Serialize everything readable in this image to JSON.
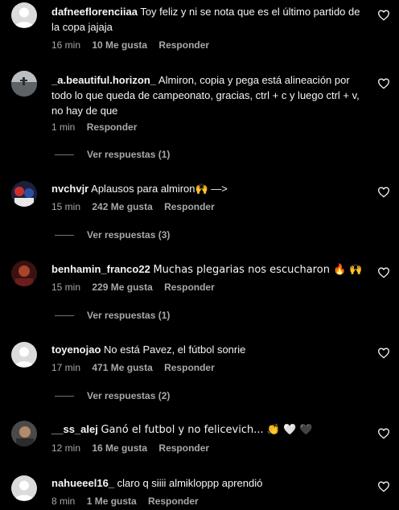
{
  "comments": [
    {
      "username": "dafneeflorenciiaa",
      "text": "Toy feliz y ni se nota que es el último partido de la copa jajaja",
      "time": "16 min",
      "likes": "10 Me gusta",
      "reply": "Responder",
      "avatar": "default-avatar-icon"
    },
    {
      "username": "_a.beautiful.horizon_",
      "text": "Almiron, copia y pega está alineación por todo lo que queda de campeonato, gracias, ctrl + c y luego ctrl + v, no hay de que",
      "time": "1 min",
      "likes": "",
      "reply": "Responder",
      "view_replies": "Ver respuestas (1)",
      "avatar": "photo-avatar-horizon"
    },
    {
      "username": "nvchvjr",
      "text": "Aplausos para almiron🙌 —>",
      "time": "15 min",
      "likes": "242 Me gusta",
      "reply": "Responder",
      "view_replies": "Ver respuestas (3)",
      "avatar": "photo-avatar-nvchvjr"
    },
    {
      "username": "benhamin_franco22",
      "text": "Muchas plegarias nos escucharon 🔥 🙌",
      "time": "15 min",
      "likes": "229 Me gusta",
      "reply": "Responder",
      "view_replies": "Ver respuestas (1)",
      "avatar": "photo-avatar-benhamin"
    },
    {
      "username": "toyenojao",
      "text": "No está Pavez, el fútbol sonrie",
      "time": "17 min",
      "likes": "471 Me gusta",
      "reply": "Responder",
      "view_replies": "Ver respuestas (2)",
      "avatar": "default-avatar-icon"
    },
    {
      "username": "__ss_alej",
      "text": "Ganó el futbol y no felicevich... 👏 🤍 🖤",
      "time": "12 min",
      "likes": "16 Me gusta",
      "reply": "Responder",
      "avatar": "photo-avatar-alej"
    },
    {
      "username": "nahueeel16_",
      "text": "claro q siiii almikloppp aprendió",
      "time": "8 min",
      "likes": "1 Me gusta",
      "reply": "Responder",
      "avatar": "default-avatar-icon"
    }
  ],
  "colors": {
    "background": "#000000",
    "primary_text": "#f5f5f5",
    "secondary_text": "#a8a8a8",
    "heart_outline": "#f5f5f5"
  },
  "icons": {
    "like": "heart-outline-icon"
  }
}
